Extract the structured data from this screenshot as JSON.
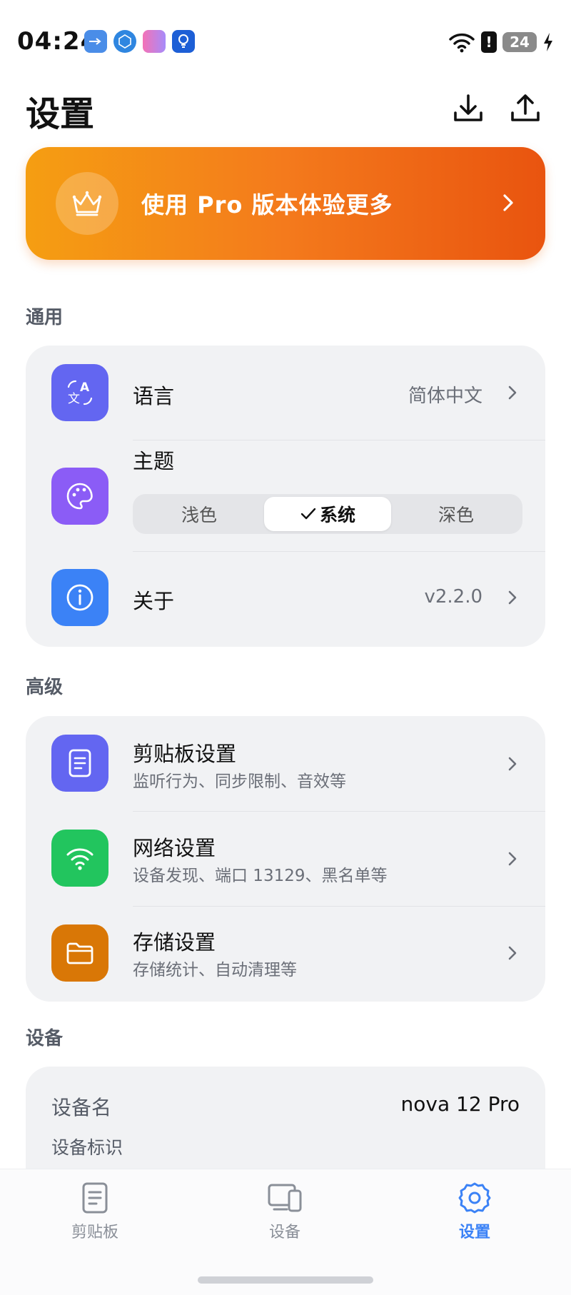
{
  "status_bar": {
    "time": "04:24",
    "battery_level": "24"
  },
  "header": {
    "title": "设置"
  },
  "pro_banner": {
    "text": "使用 Pro 版本体验更多"
  },
  "sections": {
    "general": {
      "title": "通用",
      "language": {
        "label": "语言",
        "value": "简体中文"
      },
      "theme": {
        "label": "主题",
        "options": [
          "浅色",
          "系统",
          "深色"
        ],
        "selected": "系统"
      },
      "about": {
        "label": "关于",
        "value": "v2.2.0"
      }
    },
    "advanced": {
      "title": "高级",
      "clipboard": {
        "label": "剪贴板设置",
        "desc": "监听行为、同步限制、音效等"
      },
      "network": {
        "label": "网络设置",
        "desc": "设备发现、端口 13129、黑名单等"
      },
      "storage": {
        "label": "存储设置",
        "desc": "存储统计、自动清理等"
      }
    },
    "device": {
      "title": "设备",
      "name_label": "设备名",
      "name_value": "nova 12 Pro",
      "id_label": "设备标识"
    }
  },
  "bottom_nav": {
    "items": [
      {
        "label": "剪贴板",
        "icon": "clipboard-icon"
      },
      {
        "label": "设备",
        "icon": "devices-icon"
      },
      {
        "label": "设置",
        "icon": "gear-icon"
      }
    ],
    "active": "设置"
  },
  "colors": {
    "accent": "#3b82f6",
    "pro_gradient_start": "#f59e12",
    "pro_gradient_end": "#e9540f",
    "language_icon_bg": "#6366f1",
    "theme_icon_bg": "#8b5cf6",
    "about_icon_bg": "#3b82f6",
    "clipboard_icon_bg": "#6366f1",
    "network_icon_bg": "#22c55e",
    "storage_icon_bg": "#d97706"
  }
}
